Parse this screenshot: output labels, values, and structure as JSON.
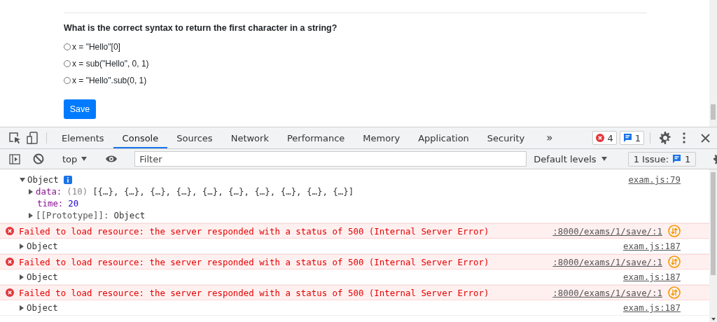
{
  "page": {
    "question": "What is the correct syntax to return the first character in a string?",
    "options": [
      {
        "label": "x = \"Hello\"[0]",
        "selected": false
      },
      {
        "label": "x = sub(\"Hello\", 0, 1)",
        "selected": false
      },
      {
        "label": "x = \"Hello\".sub(0, 1)",
        "selected": false
      }
    ],
    "save_button": "Save"
  },
  "devtools": {
    "tabs": [
      {
        "label": "Elements",
        "selected": false
      },
      {
        "label": "Console",
        "selected": true
      },
      {
        "label": "Sources",
        "selected": false
      },
      {
        "label": "Network",
        "selected": false
      },
      {
        "label": "Performance",
        "selected": false
      },
      {
        "label": "Memory",
        "selected": false
      },
      {
        "label": "Application",
        "selected": false
      },
      {
        "label": "Security",
        "selected": false
      }
    ],
    "more_tabs": "»",
    "error_count": "4",
    "message_count": "1",
    "context": "top",
    "filter": {
      "placeholder": "Filter"
    },
    "levels": "Default levels",
    "issues": {
      "label": "1 Issue:",
      "count": "1"
    },
    "console": [
      {
        "kind": "object",
        "label": "Object",
        "expanded": true,
        "source": "exam.js:79",
        "properties": [
          {
            "kind": "array",
            "key": "data:",
            "count": "(10)",
            "value": "[{…}, {…}, {…}, {…}, {…}, {…}, {…}, {…}, {…}, {…}]"
          },
          {
            "kind": "number",
            "key": "time:",
            "value": "20"
          },
          {
            "kind": "internal",
            "key": "[[Prototype]]:",
            "value": "Object"
          }
        ]
      },
      {
        "kind": "error",
        "message": "Failed to load resource: the server responded with a status of 500 (Internal Server Error)",
        "source": ":8000/exams/1/save/:1"
      },
      {
        "kind": "object",
        "label": "Object",
        "expanded": false,
        "source": "exam.js:187"
      },
      {
        "kind": "error",
        "message": "Failed to load resource: the server responded with a status of 500 (Internal Server Error)",
        "source": ":8000/exams/1/save/:1"
      },
      {
        "kind": "object",
        "label": "Object",
        "expanded": false,
        "source": "exam.js:187"
      },
      {
        "kind": "error",
        "message": "Failed to load resource: the server responded with a status of 500 (Internal Server Error)",
        "source": ":8000/exams/1/save/:1"
      },
      {
        "kind": "object",
        "label": "Object",
        "expanded": false,
        "source": "exam.js:187"
      }
    ]
  }
}
